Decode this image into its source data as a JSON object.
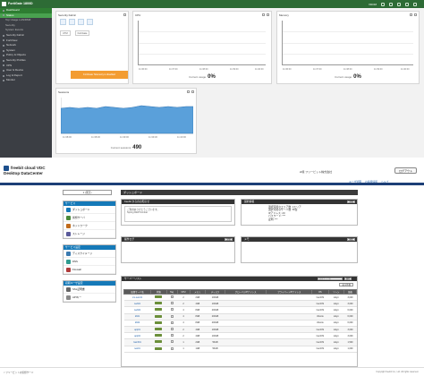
{
  "top_screenshot": {
    "topbar": {
      "brand": "FortiGate 1800D",
      "user_label": "VDOM"
    },
    "sidebar": {
      "items": [
        {
          "label": "Dashboard",
          "type": "hdr"
        },
        {
          "label": "Status",
          "type": "active"
        },
        {
          "label": "Top Usage LAN/DMZ",
          "type": "sub"
        },
        {
          "label": "Security",
          "type": "sub"
        },
        {
          "label": "System Events",
          "type": "sub"
        },
        {
          "label": "Security Fabric",
          "type": "item"
        },
        {
          "label": "FortiView",
          "type": "item"
        },
        {
          "label": "Network",
          "type": "item"
        },
        {
          "label": "System",
          "type": "item"
        },
        {
          "label": "Policy & Objects",
          "type": "item"
        },
        {
          "label": "Security Profiles",
          "type": "item"
        },
        {
          "label": "VPN",
          "type": "item"
        },
        {
          "label": "User & Device",
          "type": "item"
        },
        {
          "label": "Log & Report",
          "type": "item"
        },
        {
          "label": "Monitor",
          "type": "item"
        }
      ]
    },
    "security_fabric": {
      "title": "Security Fabric",
      "row_left": "UTM",
      "row_right": "FortiGate",
      "warning_button": "FortiGate Telemetry is disabled"
    },
    "cpu": {
      "title": "CPU",
      "usage_label": "Current usage",
      "usage_value": "0%",
      "times": [
        "11:36:00",
        "11:37:00",
        "11:38:00",
        "11:39:00",
        "11:40:00"
      ]
    },
    "memory": {
      "title": "Memory",
      "usage_label": "Current usage",
      "usage_value": "0%",
      "times": [
        "11:36:00",
        "11:37:00",
        "11:38:00",
        "11:39:00",
        "11:40:00"
      ]
    },
    "sessions": {
      "title": "Sessions",
      "count_label": "Current sessions",
      "count_value": "490",
      "times": [
        "11:38:00",
        "11:38:30",
        "11:39:00",
        "11:39:30",
        "11:40:00"
      ]
    }
  },
  "bottom_screenshot": {
    "header": {
      "logo_line1": "freebit cloud VDC",
      "logo_line2": "Desktop DataCenter",
      "user": "id様 フリービット株式会社",
      "logout": "ログアウト",
      "links": [
        "ユーザ管理",
        "お客様情報",
        "ヘルプ"
      ]
    },
    "sidebar": {
      "select": "1 (東京)",
      "panels": [
        {
          "header": "サービス",
          "items": [
            {
              "label": "ダッシュボード",
              "icon_color": "#1579b8"
            },
            {
              "label": "仮想サーバ",
              "icon_color": "#4a8a3a"
            },
            {
              "label": "ネットワーク",
              "icon_color": "#c06a1a"
            },
            {
              "label": "ストレージ",
              "icon_color": "#5a5a9a"
            }
          ]
        },
        {
          "header": "サービス設定",
          "items": [
            {
              "label": "ディスクイメージ",
              "icon_color": "#3a7ab0"
            },
            {
              "label": "DNS",
              "icon_color": "#2f9b8f"
            },
            {
              "label": "Firewall",
              "icon_color": "#b03a3a"
            }
          ]
        },
        {
          "header": "初期ユーザ設定",
          "items": [
            {
              "label": "SSL証明書",
              "icon_color": "#666666"
            },
            {
              "label": "APIキー",
              "icon_color": "#888888"
            }
          ]
        }
      ]
    },
    "main": {
      "title": "ダッシュボード",
      "notice": {
        "title": "freebit からのお知らせ",
        "text1": "ご利用ありがとうございます。",
        "text2": "Spring DEP Frontier"
      },
      "contract": {
        "title": "契約情報",
        "button": "詳細",
        "lines": [
          "選択可能なエリア数: 1エリア",
          "選択可能なサーバ数: 50台",
          "IPアドレス: 20",
          "パスワード: ***",
          "証明: ***"
        ]
      },
      "operations": {
        "title": "操作ログ",
        "button": "詳細"
      },
      "memo": {
        "title": "メモ",
        "button": "編集"
      },
      "servers": {
        "title": "サーバーリスト",
        "search_placeholder": "仮想サーバ名",
        "search_button": "検索",
        "filter": "表示件数",
        "columns": [
          "仮想サーバ名",
          "状態",
          "Tag",
          "CPU",
          "メモリ",
          "ディスク",
          "グローバルIPアドレス",
          "プライベートIPアドレス",
          "OS",
          "ゾーン",
          "価格"
        ],
        "rows": [
          {
            "name": "vm-test-01",
            "cpu": "2",
            "mem": "2GB",
            "disk": "100GB",
            "gip": "",
            "pip": "",
            "os": "CentOS",
            "zone": "tokyo",
            "price": "3,000"
          },
          {
            "name": "web01",
            "cpu": "2",
            "mem": "4GB",
            "disk": "100GB",
            "gip": "",
            "pip": "",
            "os": "CentOS",
            "zone": "tokyo",
            "price": "3,000"
          },
          {
            "name": "web02",
            "cpu": "4",
            "mem": "8GB",
            "disk": "200GB",
            "gip": "",
            "pip": "",
            "os": "CentOS",
            "zone": "tokyo",
            "price": "6,000"
          },
          {
            "name": "db01",
            "cpu": "4",
            "mem": "8GB",
            "disk": "200GB",
            "gip": "",
            "pip": "",
            "os": "Ubuntu",
            "zone": "tokyo",
            "price": "6,000"
          },
          {
            "name": "db02",
            "cpu": "4",
            "mem": "8GB",
            "disk": "200GB",
            "gip": "",
            "pip": "",
            "os": "Ubuntu",
            "zone": "tokyo",
            "price": "6,000"
          },
          {
            "name": "app01",
            "cpu": "2",
            "mem": "4GB",
            "disk": "100GB",
            "gip": "",
            "pip": "",
            "os": "CentOS",
            "zone": "tokyo",
            "price": "3,000"
          },
          {
            "name": "app02",
            "cpu": "2",
            "mem": "4GB",
            "disk": "100GB",
            "gip": "",
            "pip": "",
            "os": "CentOS",
            "zone": "tokyo",
            "price": "3,000"
          },
          {
            "name": "batch01",
            "cpu": "1",
            "mem": "2GB",
            "disk": "50GB",
            "gip": "",
            "pip": "",
            "os": "CentOS",
            "zone": "tokyo",
            "price": "1,500"
          },
          {
            "name": "test01",
            "cpu": "1",
            "mem": "1GB",
            "disk": "50GB",
            "gip": "",
            "pip": "",
            "os": "CentOS",
            "zone": "tokyo",
            "price": "1,000"
          }
        ]
      }
    },
    "footer": {
      "left": "< フリービットの仮想サーバ",
      "right": "Copyright freebit Co., Ltd. All rights reserved."
    }
  }
}
